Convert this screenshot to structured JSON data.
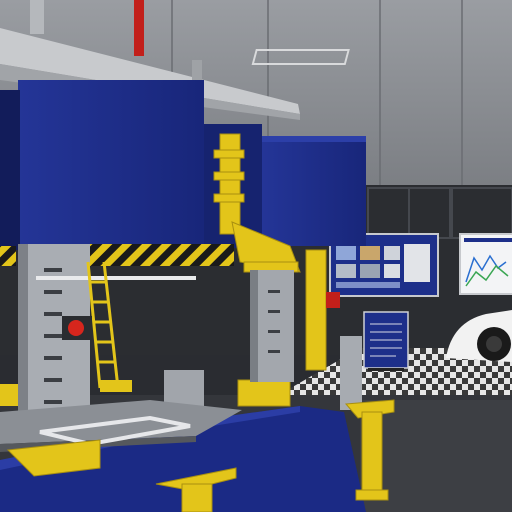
{
  "scene": {
    "palette": {
      "wall": "#8e9196",
      "wall_dark": "#6f7277",
      "machine_blue": "#1f2f8f",
      "machine_blue_dark": "#152069",
      "fixture_yellow": "#e3c51a",
      "fixture_yellow_dark": "#a88f10",
      "steel": "#a9adb3",
      "steel_dark": "#6c7076",
      "floor": "#34363b",
      "screen_blue": "#1d2f8a",
      "accent_red": "#d7261d"
    },
    "icons": {
      "car": "car-icon",
      "button": "stop-button-icon"
    }
  }
}
